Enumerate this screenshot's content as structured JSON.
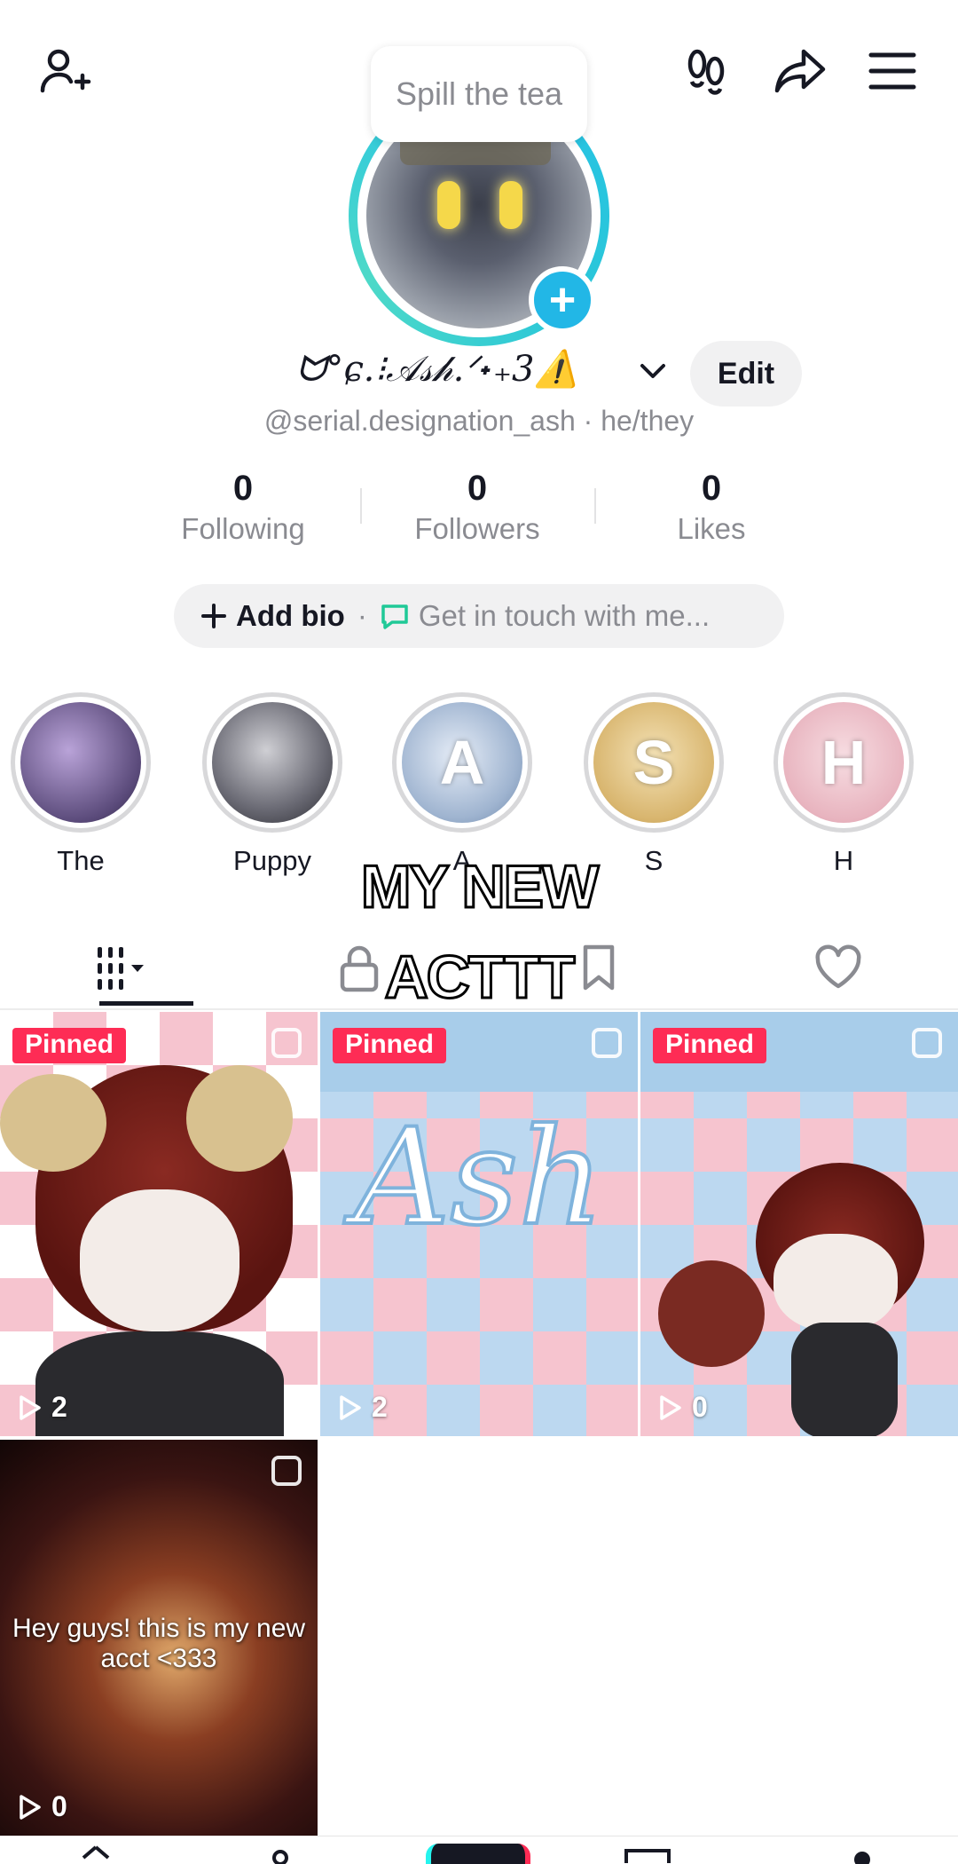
{
  "tooltip": {
    "text": "Spill the tea"
  },
  "profile": {
    "display_name": "ᗢ°ɕ.⁝𝒜𝓈𝒽.ᐟ˖₊3⚠️",
    "edit_label": "Edit",
    "handle_line": "@serial.designation_ash · he/they"
  },
  "stats": [
    {
      "value": "0",
      "label": "Following"
    },
    {
      "value": "0",
      "label": "Followers"
    },
    {
      "value": "0",
      "label": "Likes"
    }
  ],
  "bio": {
    "add_label": "Add bio",
    "separator": "·",
    "contact_label": "Get in touch with me..."
  },
  "highlights": [
    {
      "label": "The",
      "letter": ""
    },
    {
      "label": "Puppy",
      "letter": ""
    },
    {
      "label": "A",
      "letter": "A"
    },
    {
      "label": "S",
      "letter": "S"
    },
    {
      "label": "H",
      "letter": "H"
    }
  ],
  "overlay_caption": {
    "line1": "MY NEW",
    "line2": "ACTTT"
  },
  "videos": [
    {
      "pinned_label": "Pinned",
      "views": "2"
    },
    {
      "pinned_label": "Pinned",
      "views": "2",
      "art_text": "Ash"
    },
    {
      "pinned_label": "Pinned",
      "views": "0"
    },
    {
      "caption": "Hey guys! this is my new acct <333",
      "views": "0"
    }
  ],
  "colors": {
    "accent": "#fe2c55",
    "ring": "#25c2e6",
    "muted": "#8a8b91"
  }
}
